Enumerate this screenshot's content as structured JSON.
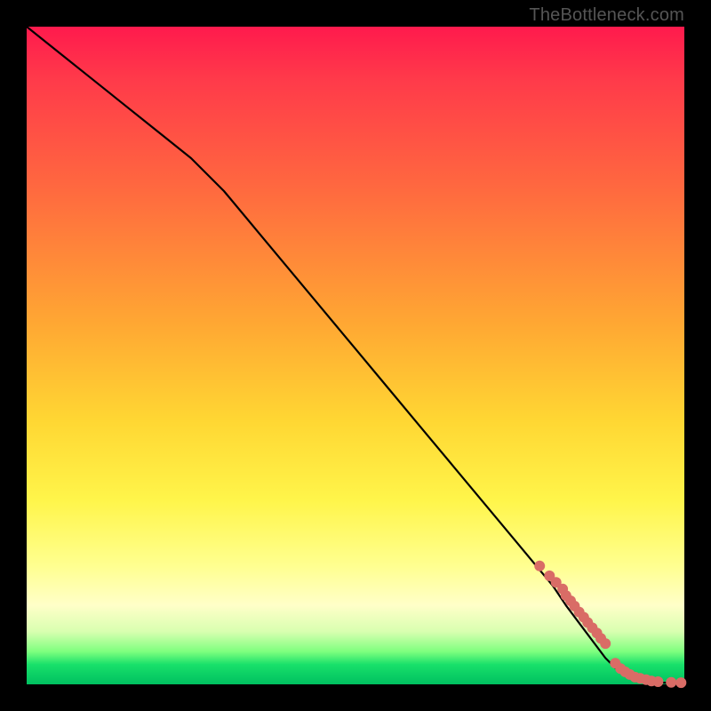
{
  "attribution": "TheBottleneck.com",
  "chart_data": {
    "type": "line",
    "title": "",
    "xlabel": "",
    "ylabel": "",
    "xlim": [
      0,
      100
    ],
    "ylim": [
      0,
      100
    ],
    "x": [
      0,
      5,
      10,
      15,
      20,
      25,
      30,
      35,
      40,
      45,
      50,
      55,
      60,
      65,
      70,
      75,
      80,
      82,
      85,
      88,
      90,
      92,
      94,
      96,
      98,
      100
    ],
    "values": [
      100,
      96,
      92,
      88,
      84,
      80,
      75,
      69,
      63,
      57,
      51,
      45,
      39,
      33,
      27,
      21,
      15,
      12,
      8,
      4,
      2,
      1,
      0.5,
      0.3,
      0.2,
      0.2
    ],
    "markers": {
      "x": [
        78,
        79.5,
        80.5,
        81.5,
        82,
        82.7,
        83.3,
        84,
        84.7,
        85.3,
        86,
        86.7,
        87.3,
        88,
        89.5,
        90.3,
        91,
        91.7,
        92.5,
        93.3,
        94.2,
        95,
        96,
        98,
        99.5
      ],
      "y": [
        18,
        16.5,
        15.5,
        14.5,
        13.5,
        12.7,
        11.9,
        11,
        10.2,
        9.4,
        8.6,
        7.8,
        7.0,
        6.2,
        3.2,
        2.4,
        1.9,
        1.5,
        1.1,
        0.9,
        0.7,
        0.5,
        0.4,
        0.3,
        0.25
      ]
    },
    "marker_color": "#d96c66",
    "line_color": "#000000",
    "background": "rainbow-vertical"
  }
}
